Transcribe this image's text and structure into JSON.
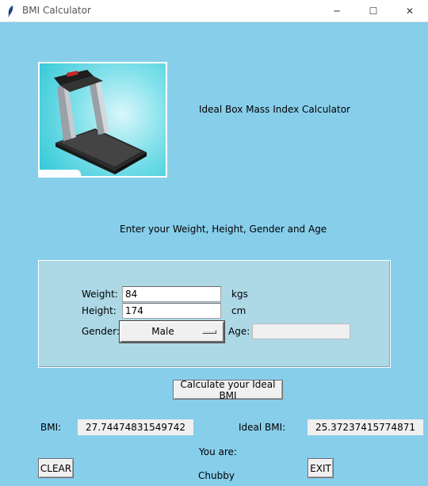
{
  "window": {
    "title": "BMI Calculator",
    "controls": {
      "minimize": "─",
      "maximize": "☐",
      "close": "✕"
    }
  },
  "header": {
    "image_icon": "treadmill-image",
    "heading": "Ideal Box Mass Index Calculator",
    "instruction": "Enter your Weight, Height, Gender and Age"
  },
  "form": {
    "weight_label": "Weight:",
    "weight_value": "84",
    "weight_unit": "kgs",
    "height_label": "Height:",
    "height_value": "174",
    "height_unit": "cm",
    "gender_label": "Gender:",
    "gender_value": "Male",
    "age_label": "Age:",
    "age_value": ""
  },
  "actions": {
    "calculate_label": "Calculate your Ideal BMI",
    "clear_label": "CLEAR",
    "exit_label": "EXIT"
  },
  "results": {
    "bmi_label": "BMI:",
    "bmi_value": "27.74474831549742",
    "ideal_bmi_label": "Ideal BMI:",
    "ideal_bmi_value": "25.37237415774871",
    "you_are_label": "You are:",
    "category": "Chubby"
  },
  "colors": {
    "background": "#87ceeb",
    "panel": "#add8e6",
    "button_face": "#f0f0f0"
  }
}
